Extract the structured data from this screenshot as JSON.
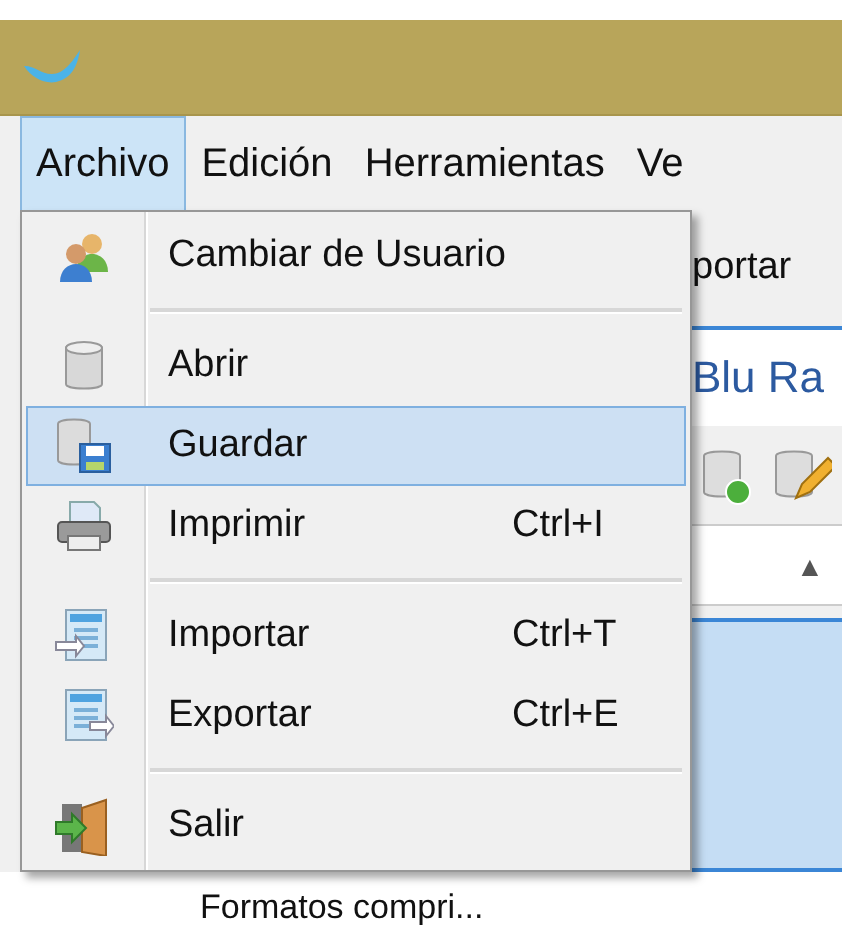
{
  "menu_bar": [
    {
      "label": "Archivo",
      "selected": true
    },
    {
      "label": "Edición",
      "selected": false
    },
    {
      "label": "Herramientas",
      "selected": false
    },
    {
      "label": "Ve",
      "selected": false
    }
  ],
  "background": {
    "toolbar_text": "portar",
    "heading": "Blu Ra",
    "sort_arrow": "▲",
    "row_text": "Formatos compri..."
  },
  "dropdown": [
    {
      "kind": "item",
      "label": "Cambiar de Usuario",
      "selected": false
    },
    {
      "kind": "separator"
    },
    {
      "kind": "item",
      "label": "Abrir",
      "selected": false
    },
    {
      "kind": "item",
      "label": "Guardar",
      "selected": true
    },
    {
      "kind": "item",
      "label": "Imprimir",
      "shortcut": "Ctrl+I",
      "selected": false
    },
    {
      "kind": "separator"
    },
    {
      "kind": "item",
      "label": "Importar",
      "shortcut": "Ctrl+T",
      "selected": false
    },
    {
      "kind": "item",
      "label": "Exportar",
      "shortcut": "Ctrl+E",
      "selected": false
    },
    {
      "kind": "separator"
    },
    {
      "kind": "item",
      "label": "Salir",
      "selected": false
    }
  ]
}
